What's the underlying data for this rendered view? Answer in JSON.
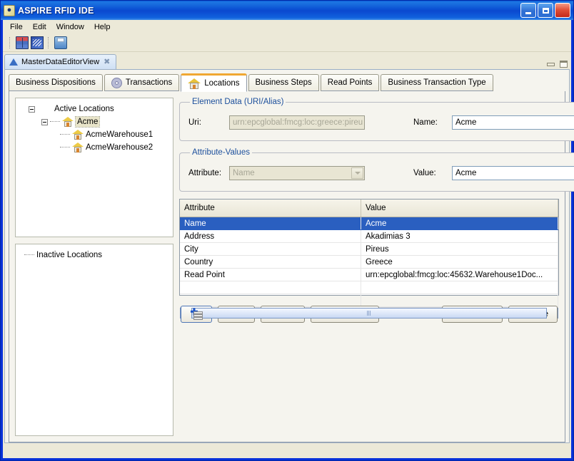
{
  "window": {
    "title": "ASPIRE RFID IDE",
    "icon": "app-icon",
    "minimize_label": "Minimize",
    "maximize_label": "Maximize",
    "close_label": "×"
  },
  "menubar": {
    "items": [
      {
        "label": "File"
      },
      {
        "label": "Edit"
      },
      {
        "label": "Window"
      },
      {
        "label": "Help"
      }
    ]
  },
  "toolbar": {
    "items": [
      {
        "name": "database-icon"
      },
      {
        "name": "network-icon"
      },
      {
        "name": "print-icon"
      }
    ]
  },
  "view": {
    "tab_label": "MasterDataEditorView",
    "close_glyph": "✖",
    "minimize_label": "",
    "maximize_label": ""
  },
  "tabs": [
    {
      "label": "Business Dispositions",
      "icon": null,
      "active": false
    },
    {
      "label": "Transactions",
      "icon": "gear-icon",
      "active": false
    },
    {
      "label": "Locations",
      "icon": "house-icon",
      "active": true
    },
    {
      "label": "Business Steps",
      "icon": null,
      "active": false
    },
    {
      "label": "Read Points",
      "icon": null,
      "active": false
    },
    {
      "label": "Business Transaction Type",
      "icon": null,
      "active": false
    }
  ],
  "tree": {
    "active": {
      "root": "Active Locations",
      "child": "Acme",
      "leaves": [
        "AcmeWarehouse1",
        "AcmeWarehouse2"
      ]
    },
    "inactive": {
      "root": "Inactive Locations"
    }
  },
  "element_data": {
    "legend": "Element Data (URI/Alias)",
    "uri_label": "Uri:",
    "uri_value": "urn:epcglobal:fmcg:loc:greece:pireu",
    "name_label": "Name:",
    "name_value": "Acme"
  },
  "attribute_values": {
    "legend": "Attribute-Values",
    "attribute_label": "Attribute:",
    "attribute_value": "Name",
    "value_label": "Value:",
    "value_value": "Acme"
  },
  "table": {
    "columns": [
      "Attribute",
      "Value"
    ],
    "rows": [
      {
        "attribute": "Name",
        "value": "Acme",
        "selected": true
      },
      {
        "attribute": "Address",
        "value": "Akadimias 3",
        "selected": false
      },
      {
        "attribute": "City",
        "value": "Pireus",
        "selected": false
      },
      {
        "attribute": "Country",
        "value": "Greece",
        "selected": false
      },
      {
        "attribute": "Read Point",
        "value": "urn:epcglobal:fmcg:loc:45632.Warehouse1Doc...",
        "selected": false
      },
      {
        "attribute": "",
        "value": "",
        "selected": false
      },
      {
        "attribute": "",
        "value": "",
        "selected": false
      }
    ],
    "scroll_left_glyph": "❮",
    "scroll_right_glyph": "❯"
  },
  "buttons": {
    "add_icon_name": "add-database-icon",
    "save": "Save",
    "cancel": "Cancel",
    "new_location": "New Location",
    "readpoints": "ReadPoints",
    "attribute": "Attribute"
  },
  "colors": {
    "title_blue": "#0a48cf",
    "accent_orange": "#f0a732",
    "selection_blue": "#2a5fc0",
    "group_legend": "#1c4f9c",
    "client_bg": "#ece9d8"
  }
}
